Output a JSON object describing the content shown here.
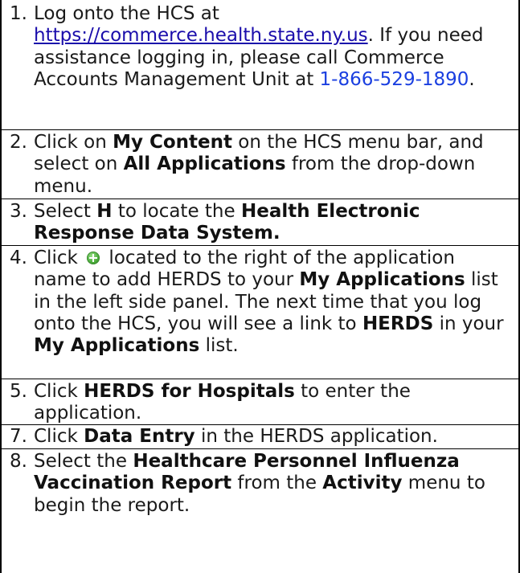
{
  "steps": [
    {
      "number": "1.",
      "text1": "Log onto the HCS at ",
      "link": "https://commerce.health.state.ny.us",
      "text2": ". If you need assistance logging in, please call Commerce Accounts Management Unit at ",
      "phone": "1-866-529-1890",
      "text3": "."
    },
    {
      "number": "2.",
      "text1": "Click on ",
      "bold1": "My Content",
      "text2": " on the HCS menu bar, and select on ",
      "bold2": "All Applications",
      "text3": " from the drop-down menu."
    },
    {
      "number": "3.",
      "text1": "Select ",
      "bold1": "H",
      "text2": " to locate the ",
      "bold2": "Health Electronic Response Data System."
    },
    {
      "number": "4.",
      "text1": "Click ",
      "icon": "add-circle-icon",
      "text2": " located to the right of the application name to add HERDS to your ",
      "bold1": "My Applications",
      "text3": " list in the left side panel. The next time that you log onto the HCS, you will see a link to ",
      "bold2": "HERDS",
      "text4": " in your ",
      "bold3": "My Applications",
      "text5": " list."
    },
    {
      "number": "5.",
      "text1": "Click ",
      "bold1": "HERDS for Hospitals",
      "text2": " to enter the application."
    },
    {
      "number": "7.",
      "text1": "Click ",
      "bold1": "Data Entry",
      "text2": " in the HERDS application."
    },
    {
      "number": "8.",
      "text1": "Select the ",
      "bold1": "Healthcare Personnel Influenza Vaccination Report",
      "text2": " from the ",
      "bold2": "Activity",
      "text3": " menu to begin the report."
    }
  ]
}
